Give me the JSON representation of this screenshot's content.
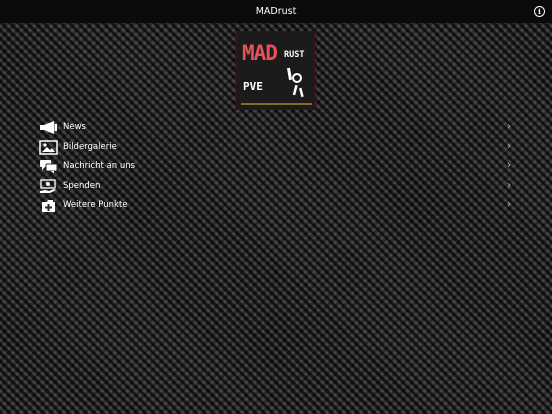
{
  "titlebar": {
    "title": "MADrust",
    "info_glyph": "i"
  },
  "logo": {
    "line1": "MAD",
    "line2": "RUST",
    "line3": "PVE"
  },
  "menu": {
    "items": [
      {
        "label": "News",
        "icon": "megaphone-icon"
      },
      {
        "label": "Bildergalerie",
        "icon": "image-icon"
      },
      {
        "label": "Nachricht an uns",
        "icon": "chat-icon"
      },
      {
        "label": "Spenden",
        "icon": "donate-icon"
      },
      {
        "label": "Weitere Punkte",
        "icon": "folder-add-icon"
      }
    ],
    "chevron": "›"
  }
}
